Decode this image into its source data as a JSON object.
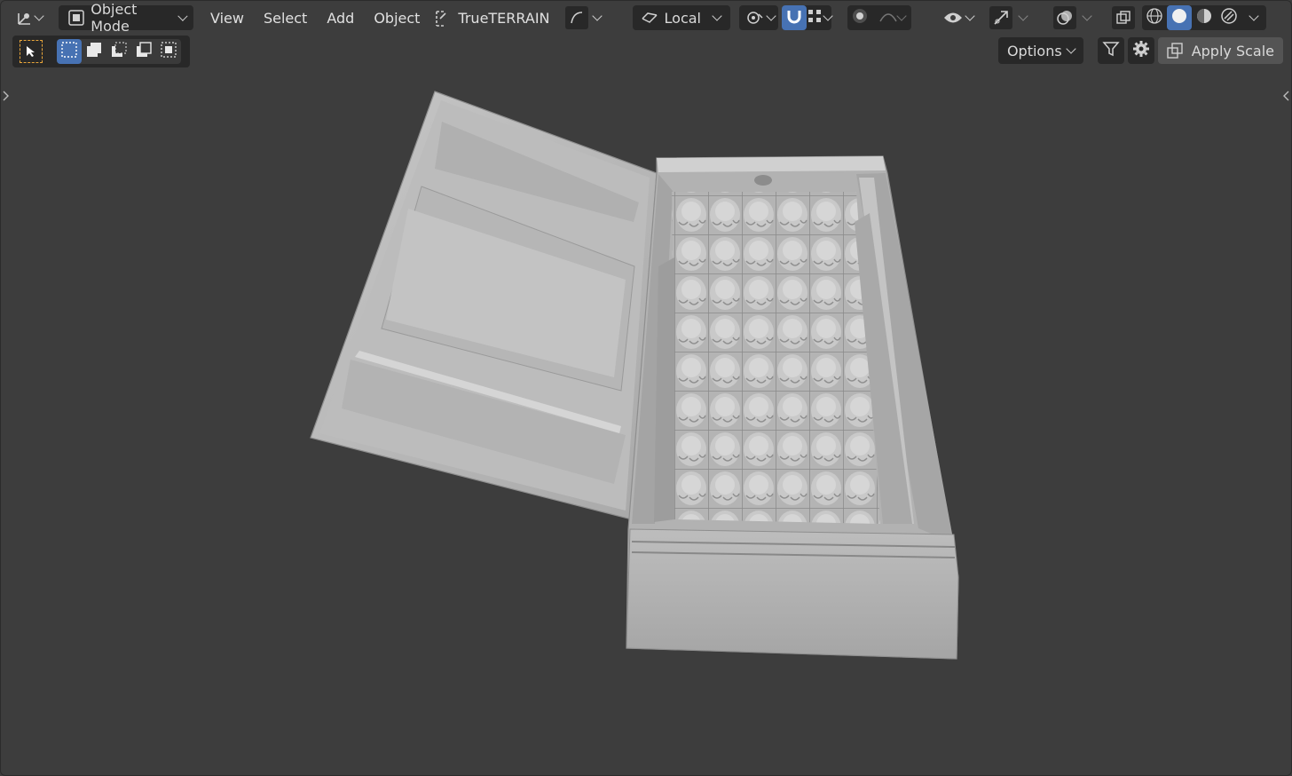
{
  "header": {
    "editor_type_icon": "axes-editor-icon",
    "mode_label": "Object Mode",
    "menus": [
      "View",
      "Select",
      "Add",
      "Object"
    ],
    "addon_label": "TrueTERRAIN",
    "transform_orientation": "Local"
  },
  "toolbar": {
    "select_modes": [
      "select-new",
      "select-extend",
      "select-subtract",
      "select-invert",
      "select-intersect"
    ]
  },
  "right": {
    "options_label": "Options",
    "apply_scale_label": "Apply Scale"
  },
  "colors": {
    "accent": "#4772b3",
    "background": "#3d3d3d",
    "header_button": "#282828",
    "select_tool_outline": "#e8a53a"
  }
}
